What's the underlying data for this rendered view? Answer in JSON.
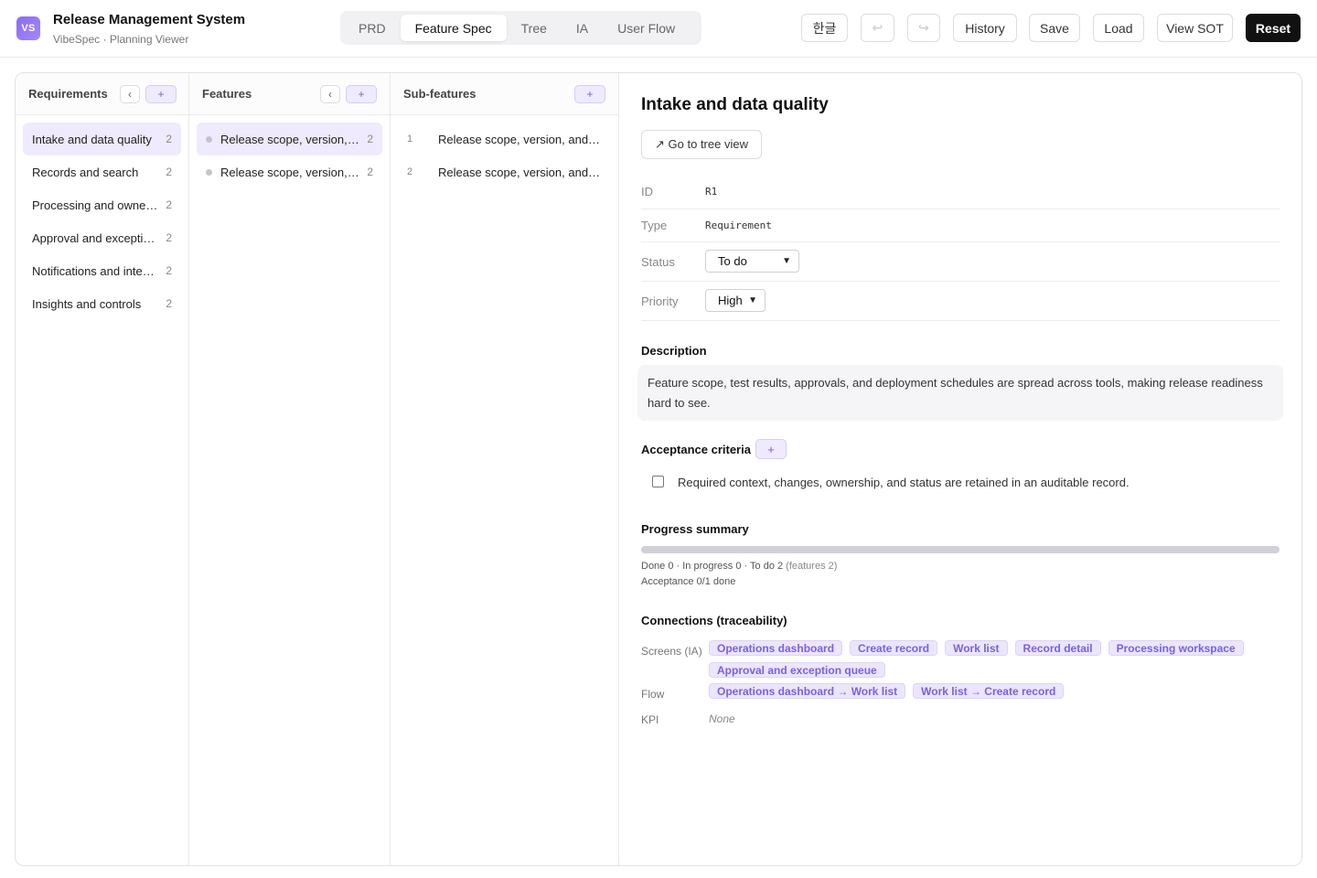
{
  "header": {
    "logo": "VS",
    "title": "Release Management System",
    "subtitle": "VibeSpec · Planning Viewer",
    "tabs": [
      {
        "label": "PRD",
        "active": false
      },
      {
        "label": "Feature Spec",
        "active": true
      },
      {
        "label": "Tree",
        "active": false
      },
      {
        "label": "IA",
        "active": false
      },
      {
        "label": "User Flow",
        "active": false
      }
    ],
    "lang_label": "한글",
    "undo_icon": "↩",
    "redo_icon": "↪",
    "history_label": "History",
    "save_label": "Save",
    "load_label": "Load",
    "sot_label": "View SOT",
    "reset_label": "Reset"
  },
  "columns": {
    "requirements": {
      "title": "Requirements",
      "back": "‹",
      "add": "+",
      "items": [
        {
          "label": "Intake and data quality",
          "count": "2",
          "active": true
        },
        {
          "label": "Records and search",
          "count": "2",
          "active": false
        },
        {
          "label": "Processing and ownership",
          "count": "2",
          "active": false
        },
        {
          "label": "Approval and exceptions",
          "count": "2",
          "active": false
        },
        {
          "label": "Notifications and integrations",
          "count": "2",
          "active": false
        },
        {
          "label": "Insights and controls",
          "count": "2",
          "active": false
        }
      ]
    },
    "features": {
      "title": "Features",
      "back": "‹",
      "add": "+",
      "items": [
        {
          "label": "Release scope, version, and ownership",
          "count": "2",
          "active": true
        },
        {
          "label": "Release scope, version, and readiness",
          "count": "2",
          "active": false
        }
      ]
    },
    "subfeatures": {
      "title": "Sub-features",
      "add": "+",
      "items": [
        {
          "num": "1",
          "label": "Release scope, version, and ownership details"
        },
        {
          "num": "2",
          "label": "Release scope, version, and readiness checks"
        }
      ]
    }
  },
  "detail": {
    "title": "Intake and data quality",
    "goto_label": "↗ Go to tree view",
    "id_key": "ID",
    "id_value": "R1",
    "type_key": "Type",
    "type_value": "Requirement",
    "status_key": "Status",
    "status_value": "To do",
    "priority_key": "Priority",
    "priority_value": "High",
    "description_heading": "Description",
    "description": "Feature scope, test results, approvals, and deployment schedules are spread across tools, making release readiness hard to see.",
    "acceptance_heading": "Acceptance criteria",
    "acceptance_add": "+",
    "criteria": [
      {
        "text": "Required context, changes, ownership, and status are retained in an auditable record.",
        "checked": false
      }
    ],
    "progress_heading": "Progress summary",
    "progress_fraction": 0,
    "progress_line": "Done 0 · In progress 0 · To do 2",
    "progress_features": "(features 2)",
    "acceptance_line": "Acceptance 0/1 done",
    "connections_heading": "Connections (traceability)",
    "screens_label": "Screens (IA)",
    "screens": [
      "Operations dashboard",
      "Create record",
      "Work list",
      "Record detail",
      "Processing workspace",
      "Approval and exception queue"
    ],
    "flow_label": "Flow",
    "flows": [
      "Operations dashboard → Work list",
      "Work list → Create record"
    ],
    "kpi_label": "KPI",
    "kpi_value": "None"
  },
  "colors": {
    "accent": "#7b5ee8",
    "accent_bg": "#efeafd",
    "dark": "#111111"
  }
}
